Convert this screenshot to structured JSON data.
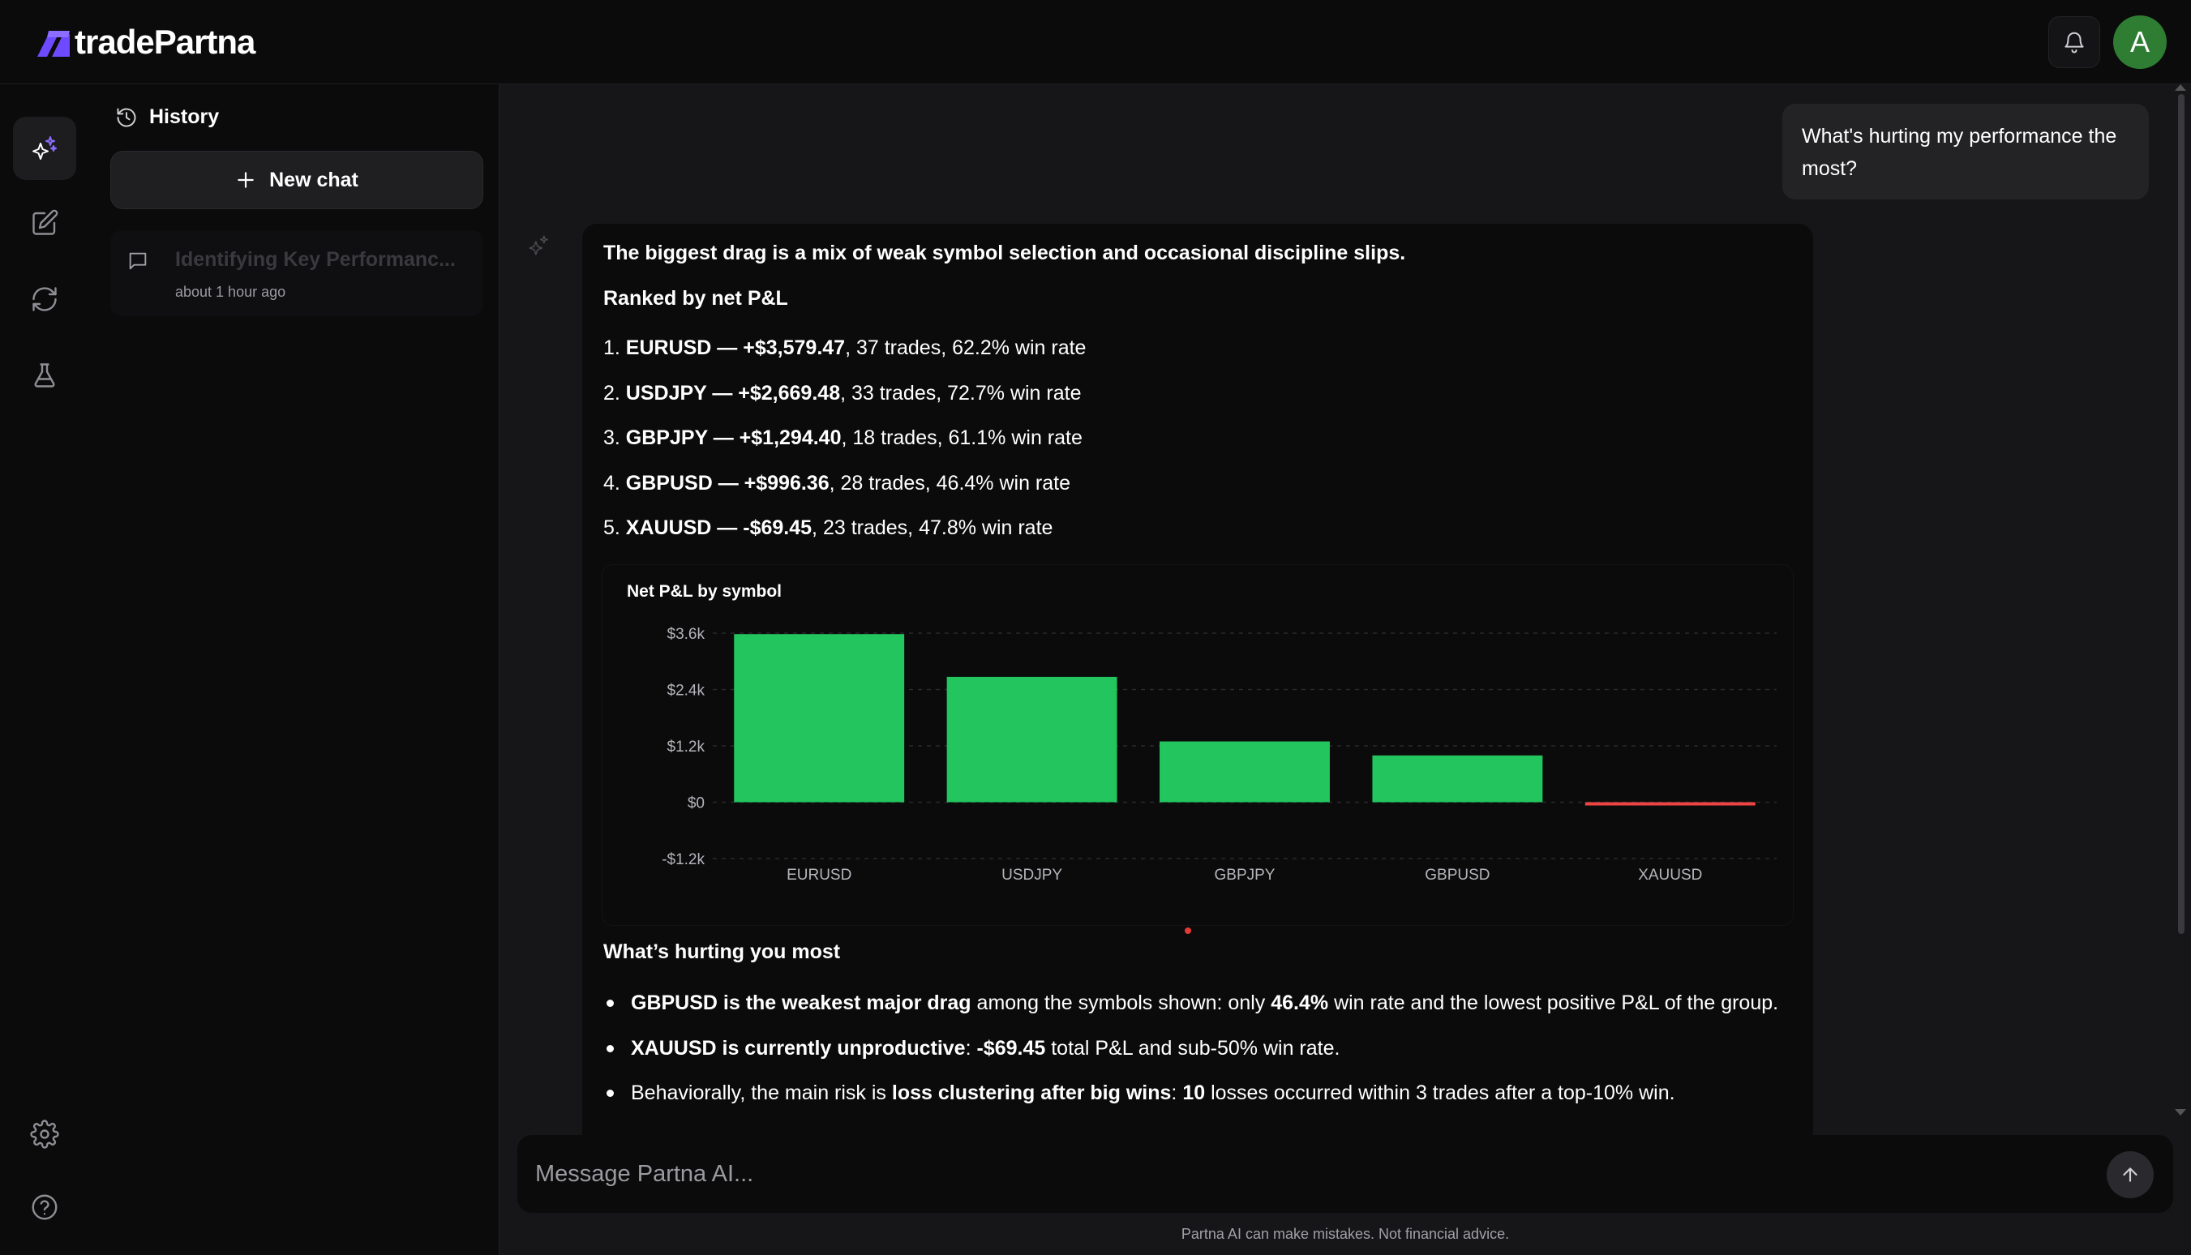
{
  "app": {
    "brand": "tradePartna",
    "avatar_initial": "A",
    "accent": "#6d4aff",
    "avatar_color": "#2e7d32"
  },
  "rail": {
    "items": [
      {
        "icon": "sparkles-icon",
        "active": true
      },
      {
        "icon": "edit-icon",
        "active": false
      },
      {
        "icon": "refresh-icon",
        "active": false
      },
      {
        "icon": "flask-icon",
        "active": false
      },
      {
        "icon": "gear-icon",
        "active": false
      },
      {
        "icon": "help-icon",
        "active": false
      }
    ]
  },
  "history": {
    "title": "History",
    "new_chat_label": "New chat",
    "chats": [
      {
        "title": "Identifying Key Performanc...",
        "time": "about 1 hour ago"
      }
    ]
  },
  "conversation": {
    "user_message": "What's hurting my performance the most?",
    "ai": {
      "lead": "The biggest drag is a mix of weak symbol selection and occasional discipline slips.",
      "ranked_heading": "Ranked by net P&L",
      "rankings": [
        {
          "prefix": "1. ",
          "bold": "EURUSD — +$3,579.47",
          "rest": ", 37 trades, 62.2% win rate"
        },
        {
          "prefix": "2. ",
          "bold": "USDJPY — +$2,669.48",
          "rest": ", 33 trades, 72.7% win rate"
        },
        {
          "prefix": "3. ",
          "bold": "GBPJPY — +$1,294.40",
          "rest": ", 18 trades, 61.1% win rate"
        },
        {
          "prefix": "4. ",
          "bold": "GBPUSD — +$996.36",
          "rest": ", 28 trades, 46.4% win rate"
        },
        {
          "prefix": "5. ",
          "bold": "XAUUSD — -$69.45",
          "rest": ", 23 trades, 47.8% win rate"
        }
      ],
      "hurting_heading": "What’s hurting you most",
      "bullets": [
        [
          {
            "t": "GBPUSD is the weakest major drag",
            "b": true
          },
          {
            "t": " among the symbols shown: only ",
            "b": false
          },
          {
            "t": "46.4%",
            "b": true
          },
          {
            "t": " win rate and the lowest positive P&L of the group.",
            "b": false
          }
        ],
        [
          {
            "t": "XAUUSD is currently unproductive",
            "b": true
          },
          {
            "t": ": ",
            "b": false
          },
          {
            "t": "-$69.45",
            "b": true
          },
          {
            "t": " total P&L and sub-50% win rate.",
            "b": false
          }
        ],
        [
          {
            "t": "Behaviorally, the main risk is ",
            "b": false
          },
          {
            "t": "loss clustering after big wins",
            "b": true
          },
          {
            "t": ": ",
            "b": false
          },
          {
            "t": "10",
            "b": true
          },
          {
            "t": " losses occurred within 3 trades after a top-10% win.",
            "b": false
          }
        ]
      ]
    }
  },
  "chart_data": {
    "type": "bar",
    "title": "Net P&L by symbol",
    "categories": [
      "EURUSD",
      "USDJPY",
      "GBPJPY",
      "GBPUSD",
      "XAUUSD"
    ],
    "values": [
      3579.47,
      2669.48,
      1294.4,
      996.36,
      -69.45
    ],
    "ylim": [
      -1200,
      3600
    ],
    "yticks": [
      {
        "v": 3600,
        "label": "$3.6k"
      },
      {
        "v": 2400,
        "label": "$2.4k"
      },
      {
        "v": 1200,
        "label": "$1.2k"
      },
      {
        "v": 0,
        "label": "$0"
      },
      {
        "v": -1200,
        "label": "-$1.2k"
      }
    ],
    "grid": true,
    "positive_color": "#22c55e",
    "negative_color": "#ef4444"
  },
  "composer": {
    "placeholder": "Message Partna AI...",
    "disclaimer": "Partna AI can make mistakes. Not financial advice."
  }
}
